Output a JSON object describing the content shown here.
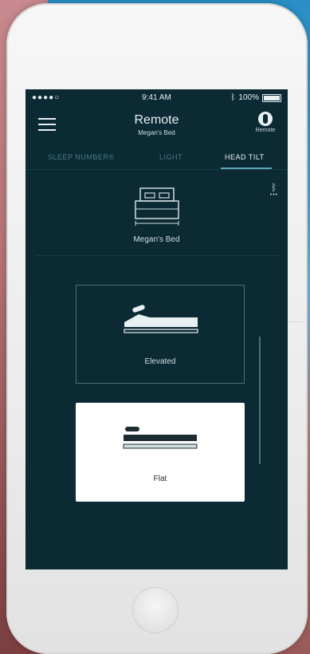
{
  "status": {
    "carrier": "●●●●○",
    "time": "9:41 AM",
    "battery_pct": "100%"
  },
  "header": {
    "title": "Remote",
    "subtitle": "Megan's Bed",
    "remote_label": "Remote"
  },
  "tabs": [
    {
      "label": "SLEEP NUMBER®"
    },
    {
      "label": "LIGHT"
    },
    {
      "label": "HEAD TILT"
    }
  ],
  "bed": {
    "name": "Megan's Bed"
  },
  "positions": [
    {
      "label": "Elevated"
    },
    {
      "label": "Flat"
    }
  ],
  "colors": {
    "screen_bg": "#0b2a33",
    "accent": "#5aa7b8",
    "card_selected_bg": "#ffffff"
  }
}
